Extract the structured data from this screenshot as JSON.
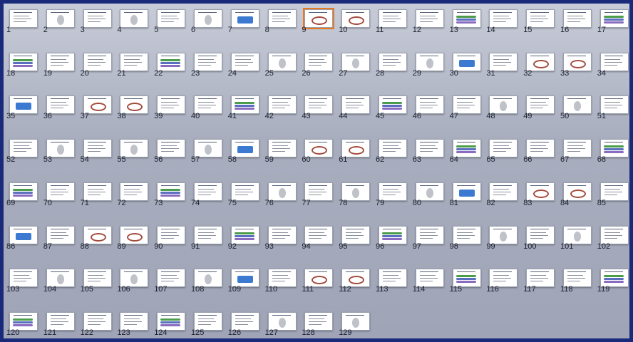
{
  "slide_sorter": {
    "selected_slide": "9",
    "slides": [
      "1",
      "2",
      "3",
      "4",
      "5",
      "6",
      "7",
      "8",
      "9",
      "10",
      "11",
      "12",
      "13",
      "14",
      "15",
      "16",
      "17",
      "18",
      "19",
      "20",
      "21",
      "22",
      "23",
      "24",
      "25",
      "26",
      "27",
      "28",
      "29",
      "30",
      "31",
      "32",
      "33",
      "34",
      "35",
      "36",
      "37",
      "38",
      "39",
      "40",
      "41",
      "42",
      "43",
      "44",
      "45",
      "46",
      "47",
      "48",
      "49",
      "50",
      "51",
      "52",
      "53",
      "54",
      "55",
      "56",
      "57",
      "58",
      "59",
      "60",
      "61",
      "62",
      "63",
      "64",
      "65",
      "66",
      "67",
      "68",
      "69",
      "70",
      "71",
      "72",
      "73",
      "74",
      "75",
      "76",
      "77",
      "78",
      "79",
      "80",
      "81",
      "82",
      "83",
      "84",
      "85",
      "86",
      "87",
      "88",
      "89",
      "90",
      "91",
      "92",
      "93",
      "94",
      "95",
      "96",
      "97",
      "98",
      "99",
      "100",
      "101",
      "102",
      "103",
      "104",
      "105",
      "106",
      "107",
      "108",
      "109",
      "110",
      "111",
      "112",
      "113",
      "114",
      "115",
      "116",
      "117",
      "118",
      "119",
      "120",
      "121",
      "122",
      "123",
      "124",
      "125",
      "126",
      "127",
      "128",
      "129"
    ]
  },
  "colors": {
    "frame_border": "#1a2a7a",
    "selection": "#e8791f",
    "background": "#a9aebf"
  }
}
